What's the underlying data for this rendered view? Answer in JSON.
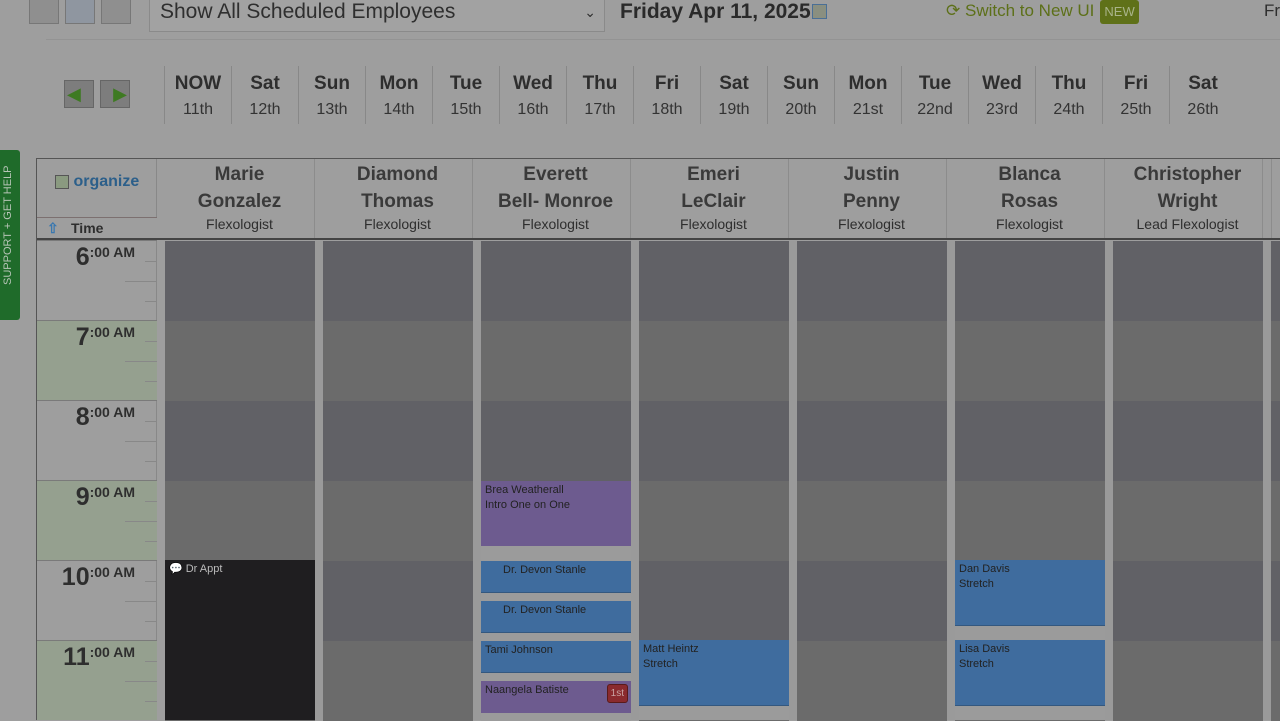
{
  "toolbar": {
    "employee_filter": "Show All Scheduled Employees",
    "date": "Friday Apr 11, 2025",
    "switch_ui": "Switch to New UI",
    "new_badge": "NEW",
    "right_cut": "Fr"
  },
  "days": [
    {
      "d": "NOW",
      "n": "11th"
    },
    {
      "d": "Sat",
      "n": "12th"
    },
    {
      "d": "Sun",
      "n": "13th"
    },
    {
      "d": "Mon",
      "n": "14th"
    },
    {
      "d": "Tue",
      "n": "15th"
    },
    {
      "d": "Wed",
      "n": "16th"
    },
    {
      "d": "Thu",
      "n": "17th"
    },
    {
      "d": "Fri",
      "n": "18th"
    },
    {
      "d": "Sat",
      "n": "19th"
    },
    {
      "d": "Sun",
      "n": "20th"
    },
    {
      "d": "Mon",
      "n": "21st"
    },
    {
      "d": "Tue",
      "n": "22nd"
    },
    {
      "d": "Wed",
      "n": "23rd"
    },
    {
      "d": "Thu",
      "n": "24th"
    },
    {
      "d": "Fri",
      "n": "25th"
    },
    {
      "d": "Sat",
      "n": "26th"
    }
  ],
  "support": "SUPPORT + GET HELP",
  "organize": "organize",
  "time_header": "Time",
  "hours": [
    {
      "h": "6",
      "m": ":00 AM"
    },
    {
      "h": "7",
      "m": ":00 AM"
    },
    {
      "h": "8",
      "m": ":00 AM"
    },
    {
      "h": "9",
      "m": ":00 AM"
    },
    {
      "h": "10",
      "m": ":00 AM"
    },
    {
      "h": "11",
      "m": ":00 AM"
    }
  ],
  "employees": [
    {
      "first": "Marie",
      "last": "Gonzalez",
      "role": "Flexologist"
    },
    {
      "first": "Diamond",
      "last": "Thomas",
      "role": "Flexologist"
    },
    {
      "first": "Everett",
      "last": "Bell- Monroe",
      "role": "Flexologist"
    },
    {
      "first": "Emeri",
      "last": "LeClair",
      "role": "Flexologist"
    },
    {
      "first": "Justin",
      "last": "Penny",
      "role": "Flexologist"
    },
    {
      "first": "Blanca",
      "last": "Rosas",
      "role": "Flexologist"
    },
    {
      "first": "Christopher",
      "last": "Wright",
      "role": "Lead Flexologist"
    }
  ],
  "events": {
    "marie": [
      {
        "title": "Dr Appt"
      }
    ],
    "everett": [
      {
        "title": "Brea Weatherall",
        "sub": "Intro One on One"
      },
      {
        "title": "Dr. Devon Stanle"
      },
      {
        "title": "Dr. Devon Stanle"
      },
      {
        "title": "Tami Johnson"
      },
      {
        "title": "Naangela Batiste",
        "badge": "1st"
      }
    ],
    "emeri": [
      {
        "title": "Matt Heintz",
        "sub": "Stretch"
      }
    ],
    "blanca": [
      {
        "title": "Dan Davis",
        "sub": "Stretch"
      },
      {
        "title": "Lisa Davis",
        "sub": "Stretch"
      }
    ]
  },
  "colors": {
    "appointment_blue": "#3f6c9e",
    "intro_purple": "#6d5b8f",
    "support_green": "#1f6b2a"
  }
}
